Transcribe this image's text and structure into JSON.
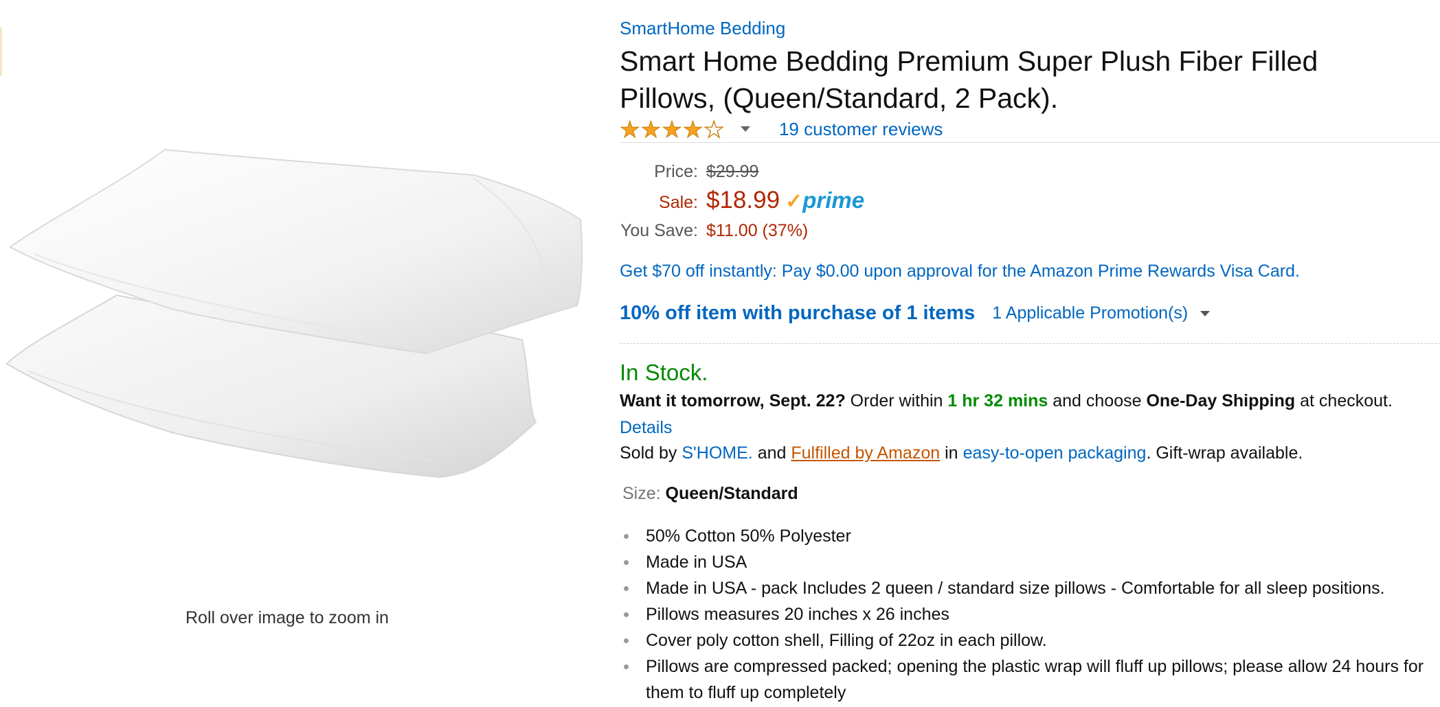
{
  "image": {
    "zoom_hint": "Roll over image to zoom in"
  },
  "product": {
    "brand": "SmartHome Bedding",
    "title": "Smart Home Bedding Premium Super Plush Fiber Filled Pillows, (Queen/Standard, 2 Pack).",
    "rating": 4,
    "rating_max": 5,
    "reviews_label": "19 customer reviews"
  },
  "pricing": {
    "price_label": "Price:",
    "list_price": "$29.99",
    "sale_label": "Sale:",
    "sale_price": "$18.99",
    "prime_check": "✓",
    "prime_label": "prime",
    "save_label": "You Save:",
    "save_value": "$11.00 (37%)"
  },
  "offers": {
    "visa_text": "Get $70 off instantly: Pay $0.00 upon approval for the Amazon Prime Rewards Visa Card.",
    "promo_main": "10% off item with purchase of 1 items",
    "promo_link": "1 Applicable Promotion(s)"
  },
  "availability": {
    "status": "In Stock.",
    "want_bold": "Want it tomorrow, Sept. 22?",
    "order_within": "Order within",
    "time_left": "1 hr 32 mins",
    "and_choose": "and choose",
    "shipping_option": "One-Day Shipping",
    "at_checkout": "at checkout.",
    "details_link": "Details",
    "sold_by": "Sold by",
    "seller": "S'HOME.",
    "and": "and",
    "fulfilled": "Fulfilled by Amazon",
    "in": "in",
    "packaging": "easy-to-open packaging",
    "gift": ". Gift-wrap available."
  },
  "size": {
    "label": "Size:",
    "value": "Queen/Standard"
  },
  "features": [
    "50% Cotton 50% Polyester",
    "Made in USA",
    "Made in USA - pack Includes 2 queen / standard size pillows - Comfortable for all sleep positions.",
    "Pillows measures 20 inches x 26 inches",
    "Cover poly cotton shell, Filling of 22oz in each pillow.",
    "Pillows are compressed packed; opening the plastic wrap will fluff up pillows; please allow 24 hours for them to fluff up completely"
  ],
  "colors": {
    "link": "#0066c0",
    "price_red": "#b12704",
    "stock_green": "#008a00",
    "star": "#f7a21e",
    "prime_blue": "#1a98d5",
    "fba_orange": "#c45500"
  },
  "icons": {
    "star_full": "star-filled-icon",
    "star_empty": "star-outline-icon",
    "rating_caret": "chevron-down-icon",
    "promo_caret": "chevron-down-icon",
    "prime": "prime-check-icon"
  }
}
